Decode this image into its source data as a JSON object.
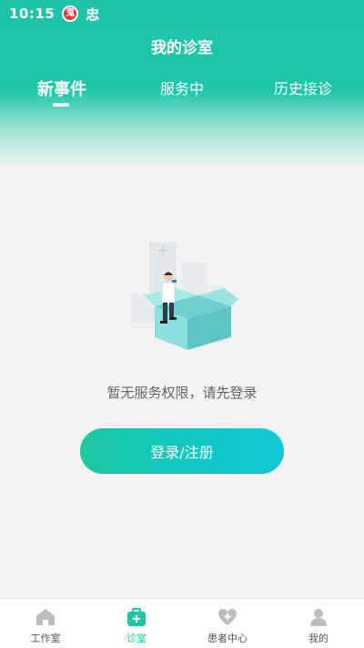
{
  "status_bar": {
    "time": "10:15",
    "badge_text": "鬼",
    "extra_glyph": "忠"
  },
  "header": {
    "title": "我的诊室"
  },
  "tabs": [
    {
      "label": "新事件",
      "active": true
    },
    {
      "label": "服务中",
      "active": false
    },
    {
      "label": "历史接诊",
      "active": false
    }
  ],
  "empty_state": {
    "message": "暂无服务权限，请先登录",
    "button_label": "登录/注册"
  },
  "bottom_nav": [
    {
      "label": "工作室",
      "icon": "home-icon",
      "active": false
    },
    {
      "label": "诊室",
      "icon": "medical-kit-icon",
      "active": true
    },
    {
      "label": "患者中心",
      "icon": "heart-plus-icon",
      "active": false
    },
    {
      "label": "我的",
      "icon": "person-icon",
      "active": false
    }
  ],
  "colors": {
    "primary": "#1fc7a6",
    "accent": "#10c9d6",
    "background": "#f2f2f2"
  }
}
